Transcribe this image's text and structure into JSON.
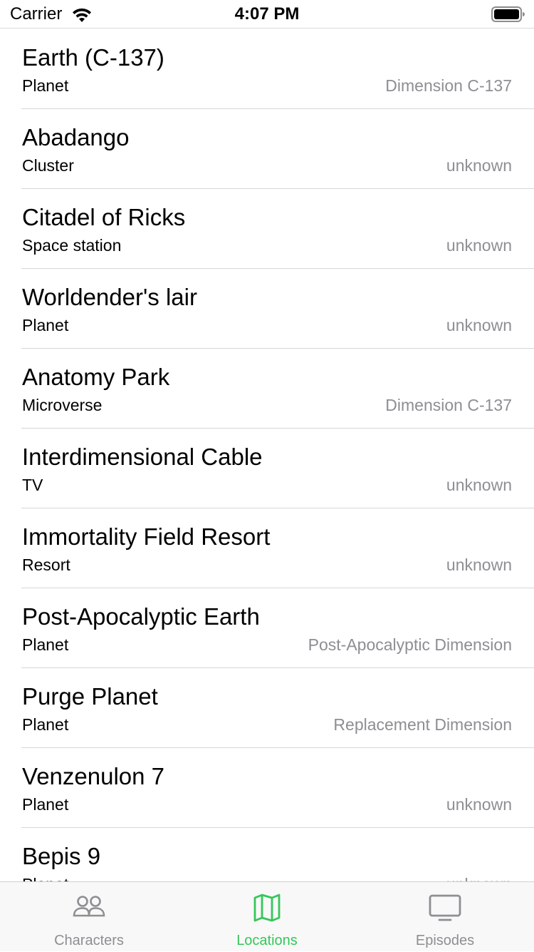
{
  "status_bar": {
    "carrier": "Carrier",
    "time": "4:07 PM"
  },
  "locations": [
    {
      "name": "Earth (C-137)",
      "type": "Planet",
      "dimension": "Dimension C-137"
    },
    {
      "name": "Abadango",
      "type": "Cluster",
      "dimension": "unknown"
    },
    {
      "name": "Citadel of Ricks",
      "type": "Space station",
      "dimension": "unknown"
    },
    {
      "name": "Worldender's lair",
      "type": "Planet",
      "dimension": "unknown"
    },
    {
      "name": "Anatomy Park",
      "type": "Microverse",
      "dimension": "Dimension C-137"
    },
    {
      "name": "Interdimensional Cable",
      "type": "TV",
      "dimension": "unknown"
    },
    {
      "name": "Immortality Field Resort",
      "type": "Resort",
      "dimension": "unknown"
    },
    {
      "name": "Post-Apocalyptic Earth",
      "type": "Planet",
      "dimension": "Post-Apocalyptic Dimension"
    },
    {
      "name": "Purge Planet",
      "type": "Planet",
      "dimension": "Replacement Dimension"
    },
    {
      "name": "Venzenulon 7",
      "type": "Planet",
      "dimension": "unknown"
    },
    {
      "name": "Bepis 9",
      "type": "Planet",
      "dimension": "unknown"
    }
  ],
  "tab_bar": {
    "tabs": [
      {
        "label": "Characters",
        "icon": "people-icon",
        "active": false
      },
      {
        "label": "Locations",
        "icon": "map-icon",
        "active": true
      },
      {
        "label": "Episodes",
        "icon": "tv-icon",
        "active": false
      }
    ]
  },
  "colors": {
    "active_tint": "#34c759",
    "inactive_tint": "#8e8e93",
    "secondary_text": "#8e8e93"
  }
}
